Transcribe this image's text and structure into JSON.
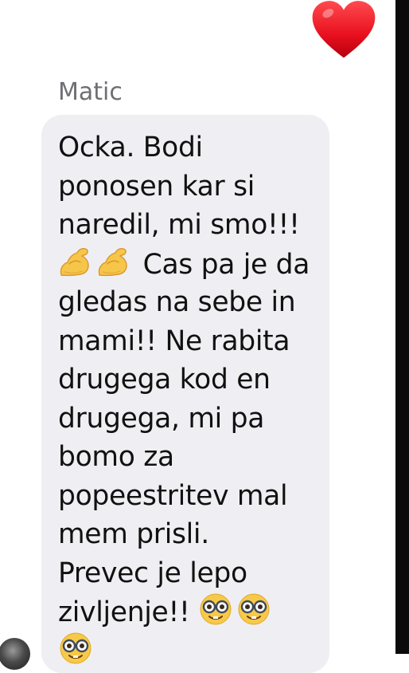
{
  "reaction": {
    "icon": "heart-icon",
    "color": "#e8101e"
  },
  "message": {
    "sender": "Matic",
    "bubble_color": "#efeff3",
    "lines": [
      {
        "emoji_before": [],
        "text": "Ocka. Bodi",
        "emoji_after": []
      },
      {
        "emoji_before": [],
        "text": "ponosen kar si",
        "emoji_after": []
      },
      {
        "emoji_before": [],
        "text": "naredil, mi smo!!!",
        "emoji_after": []
      },
      {
        "emoji_before": [
          "flexed-biceps-emoji",
          "flexed-biceps-emoji"
        ],
        "text": " Cas pa je da",
        "emoji_after": []
      },
      {
        "emoji_before": [],
        "text": "gledas na sebe in",
        "emoji_after": []
      },
      {
        "emoji_before": [],
        "text": "mami!! Ne rabita",
        "emoji_after": []
      },
      {
        "emoji_before": [],
        "text": "drugega kod en",
        "emoji_after": []
      },
      {
        "emoji_before": [],
        "text": "drugega, mi pa",
        "emoji_after": []
      },
      {
        "emoji_before": [],
        "text": "bomo za",
        "emoji_after": []
      },
      {
        "emoji_before": [],
        "text": "popeestritev mal",
        "emoji_after": []
      },
      {
        "emoji_before": [],
        "text": "mem prisli.",
        "emoji_after": []
      },
      {
        "emoji_before": [],
        "text": "Prevec je lepo",
        "emoji_after": []
      },
      {
        "emoji_before": [],
        "text": "zivljenje!! ",
        "emoji_after": [
          "nerd-face-emoji",
          "nerd-face-emoji"
        ]
      },
      {
        "emoji_before": [
          "nerd-face-emoji"
        ],
        "text": "",
        "emoji_after": []
      }
    ]
  },
  "avatar": {
    "icon": "avatar"
  }
}
